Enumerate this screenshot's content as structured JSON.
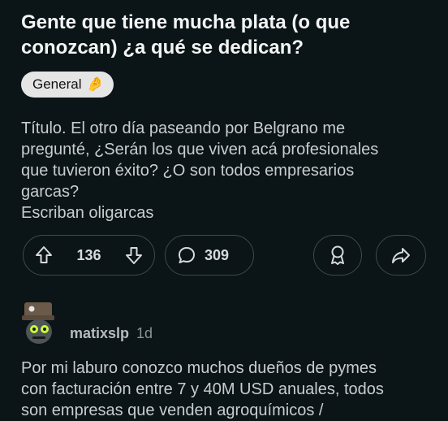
{
  "post": {
    "title": "Gente que tiene mucha plata (o que conozcan) ¿a qué se dedican?",
    "flair": {
      "label": "General",
      "emoji": "🤌"
    },
    "body_lines": [
      "Título. El otro día paseando por Belgrano me",
      "pregunté, ¿Serán los que viven acá profesionales",
      "que tuvieron éxito? ¿O son todos empresarios",
      "garcas?",
      "Escriban oligarcas"
    ],
    "upvotes": "136",
    "comments": "309"
  },
  "comment": {
    "author": "matixslp",
    "time": "1d",
    "text_lines": [
      "Por mi laburo conozco muchos dueños de pymes",
      "con facturación entre 7 y 40M USD anuales, todos",
      "son empresas que venden agroquímicos /"
    ]
  },
  "colors": {
    "background": "#0b1416",
    "pill_border": "#3e4a4f",
    "flair_bg": "#e5e5e5"
  }
}
